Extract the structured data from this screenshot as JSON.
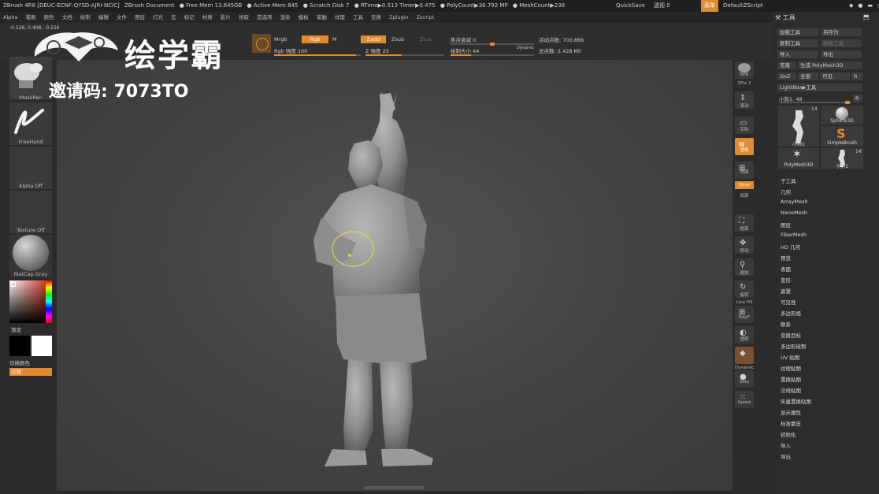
{
  "title_bar": {
    "app": "ZBrush 4R8 [DEUC-ECNF-QYSD-AJRI-NCIC]",
    "document": "ZBrush Document",
    "free_mem": "● Free Mem 13.645GB",
    "active_mem": "● Active Mem 845",
    "scratch": "● Scratch Disk 7",
    "rtime": "● RTime▶0.513 Timer▶0.475",
    "polycount": "● PolyCount▶36.792 MP",
    "meshcount": "● MeshCount▶238",
    "quicksave": "QuickSave",
    "transparency": "透视 0",
    "menu_btn": "菜单",
    "script": "DefaultZScript"
  },
  "menu": [
    "Alpha",
    "笔刷",
    "颜色",
    "文档",
    "绘制",
    "编辑",
    "文件",
    "图层",
    "灯光",
    "宏",
    "标记",
    "材质",
    "影片",
    "拾取",
    "首选项",
    "渲染",
    "模板",
    "笔触",
    "纹理",
    "工具",
    "变换",
    "Zplugin",
    "Zscript"
  ],
  "coords": "-0.126, 0.408, -0.156",
  "top_tool": {
    "mrgb": "Mrgb",
    "rgb": "Rgb",
    "m": "M",
    "zadd": "Zadd",
    "zsub": "Zsub",
    "zcut": "Zcut",
    "focal": "焦点衰减 0",
    "active_points": "活动点数: 700,866",
    "rgb_intensity": "Rgb 强度 100",
    "z_intensity": "Z 强度 25",
    "draw_size": "绘制大小 64",
    "dynamic": "Dynamic",
    "total_points": "总点数: 2.428 Mil"
  },
  "left_shelf": {
    "brush": "MaskPen",
    "stroke": "FreeHand",
    "alpha": "Alpha Off",
    "texture": "Texture Off",
    "material": "MatCap Gray",
    "gradient": "渐变",
    "switch_color": "切换颜色",
    "alternate": "交替",
    "gradient_value": 0.5
  },
  "right_shelf": {
    "bpr": "BPR",
    "spix": "SPix 3",
    "scroll": "滚动",
    "zoom": "缩放",
    "actual": "实际",
    "persp": "透视",
    "floor": "地面",
    "local": "局部",
    "xyz": "Qxyz",
    "frame": "框架",
    "move": "移动",
    "rotate": "旋转",
    "linefill": "Line Fill",
    "polyf": "PolyF",
    "transp": "透明",
    "solo": "Solo",
    "dynamic": "Dynamic",
    "xpose": "Xpose"
  },
  "tool_panel": {
    "title": "工具",
    "load": "加载工具",
    "save_as": "另存为",
    "copy": "复制工具",
    "paste": "粘贴工具",
    "import": "导入",
    "export": "导出",
    "clone": "克隆",
    "make_polymesh": "生成 PolyMesh3D",
    "goz": "GoZ",
    "all": "全部",
    "visible": "可见",
    "r": "R",
    "lightbox": "LightBox▶工具",
    "current": "小狗1. 48",
    "r2": "R",
    "thumb_count": "14",
    "thumb_count2": "14",
    "thumbs": [
      "小狗1",
      "Sphere3D",
      "SimpleBrush",
      "PolyMesh3D",
      "小狗1"
    ],
    "items": [
      "子工具",
      "几何",
      "ArrayMesh",
      "NanoMesh",
      "图层",
      "FiberMesh",
      "HD 几何",
      "预览",
      "表面",
      "变形",
      "遮罩",
      "可见性",
      "多边形组",
      "联系",
      "变换目标",
      "多边形绘制",
      "UV 贴图",
      "纹理贴图",
      "置换贴图",
      "法线贴图",
      "矢量置换贴图",
      "显示属性",
      "标准蒙皮",
      "初始化",
      "导入",
      "导出"
    ]
  },
  "watermark": {
    "brand": "绘学霸",
    "invite": "邀请码: 7073TO"
  }
}
